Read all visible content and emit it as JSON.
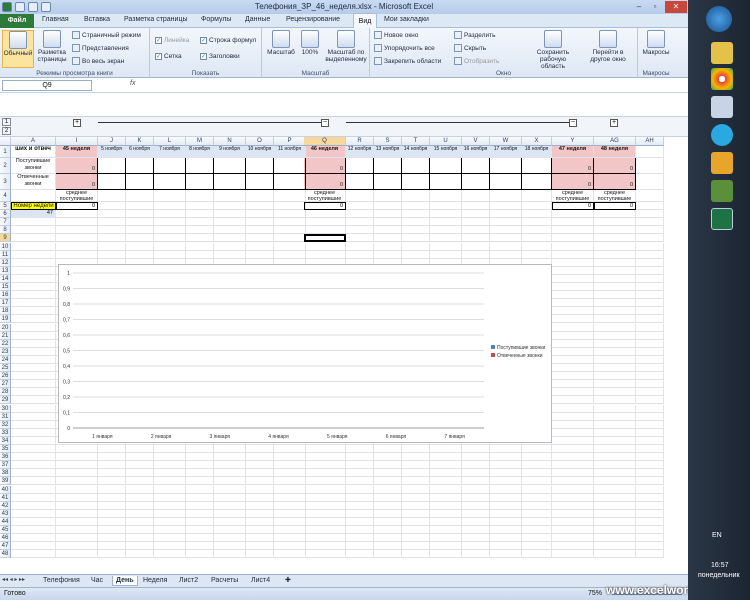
{
  "window": {
    "title": "Телефония_ЗР_46_неделя.xlsx - Microsoft Excel"
  },
  "ribbon_tabs": [
    "Файл",
    "Главная",
    "Вставка",
    "Разметка страницы",
    "Формулы",
    "Данные",
    "Рецензирование",
    "Вид",
    "Мои закладки"
  ],
  "ribbon": {
    "book_views": {
      "label": "Режимы просмотра книги",
      "normal": "Обычный",
      "page_layout": "Разметка страницы",
      "page_break": "Страничный режим",
      "custom_views": "Представления",
      "full_screen": "Во весь экран"
    },
    "show": {
      "label": "Показать",
      "ruler": "Линейка",
      "formula_bar": "Строка формул",
      "grid": "Сетка",
      "headings": "Заголовки"
    },
    "zoom": {
      "label": "Масштаб",
      "zoom": "Масштаб",
      "hundred": "100%",
      "selection": "Масштаб по выделенному"
    },
    "window": {
      "label": "Окно",
      "new_window": "Новое окно",
      "arrange_all": "Упорядочить все",
      "freeze": "Закрепить области",
      "split": "Разделить",
      "hide": "Скрыть",
      "unhide": "Отобразить",
      "save_ws": "Сохранить рабочую область",
      "switch": "Перейти в другое окно"
    },
    "macros": {
      "label": "Макросы",
      "macros": "Макросы"
    }
  },
  "formula_bar": {
    "name_box": "Q9",
    "fx": "fx"
  },
  "outline": {
    "levels": [
      "1",
      "2"
    ],
    "buttons": [
      "+",
      "−",
      "−",
      "+"
    ]
  },
  "columns": [
    "A",
    "I",
    "J",
    "K",
    "L",
    "M",
    "N",
    "O",
    "P",
    "Q",
    "R",
    "S",
    "T",
    "U",
    "V",
    "W",
    "X",
    "Y",
    "AG",
    "AH"
  ],
  "week_headers": {
    "I": "45 неделя",
    "Q": "46 неделя",
    "Y": "47 неделя",
    "AG": "48 неделя"
  },
  "day_headers": [
    "5 ноября",
    "6 ноября",
    "7 ноября",
    "8 ноября",
    "9 ноября",
    "10 ноября",
    "11 ноября",
    "12 ноября",
    "13 ноября",
    "14 ноября",
    "15 ноября",
    "16 ноября",
    "17 ноября",
    "18 ноября"
  ],
  "row_labels": {
    "r1": "ших и отвеч",
    "r2": "Поступившие звонки",
    "r3": "Отвеченные звонки",
    "r5": "Номер недели",
    "r6": "47"
  },
  "avg_label": "среднее поступившие",
  "zero": "0",
  "chart_data": {
    "type": "line",
    "categories": [
      "1 января",
      "2 января",
      "3 января",
      "4 января",
      "5 января",
      "6 января",
      "7 января"
    ],
    "y_ticks": [
      "0",
      "0,1",
      "0,2",
      "0,3",
      "0,4",
      "0,5",
      "0,6",
      "0,7",
      "0,8",
      "0,9",
      "1"
    ],
    "ylim": [
      0,
      1
    ],
    "series": [
      {
        "name": "Поступившие звонки",
        "color": "#4f81bd"
      },
      {
        "name": "Отвеченные звонки",
        "color": "#c0504d"
      }
    ]
  },
  "sheet_tabs": [
    "Телефония",
    "Час",
    "День",
    "Неделя",
    "Лист2",
    "Расчеты",
    "Лист4"
  ],
  "active_tab": "День",
  "status": {
    "ready": "Готово",
    "zoom": "75%",
    "watermark": "www.excelworld.ru"
  },
  "taskbar": {
    "lang": "EN",
    "time": "16:57",
    "day": "понедельник"
  }
}
